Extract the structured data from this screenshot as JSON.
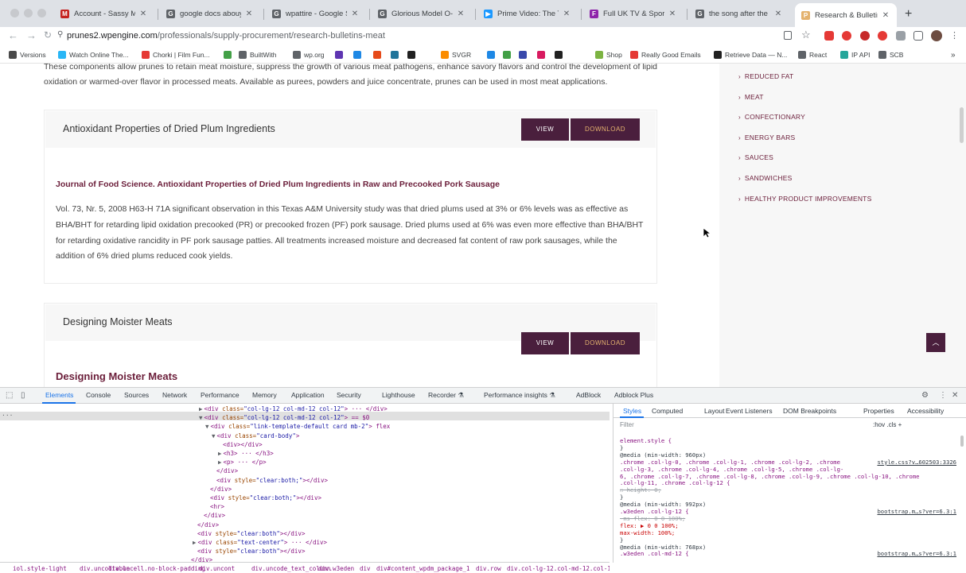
{
  "tabs": [
    {
      "title": "Account - Sassy Ma",
      "color": "#c5221f",
      "glyph": "M"
    },
    {
      "title": "google docs abouy",
      "color": "#5f6368",
      "glyph": "G"
    },
    {
      "title": "wpattire - Google Se",
      "color": "#5f6368",
      "glyph": "G"
    },
    {
      "title": "Glorious Model O- W",
      "color": "#5f6368",
      "glyph": "G"
    },
    {
      "title": "Prime Video: The Te",
      "color": "#1a98ff",
      "glyph": "▶"
    },
    {
      "title": "Full UK TV & Sports",
      "color": "#8e24aa",
      "glyph": "F"
    },
    {
      "title": "the song after the b",
      "color": "#5f6368",
      "glyph": "G"
    },
    {
      "title": "Research & Bulletins",
      "color": "#e4b26e",
      "glyph": "P"
    }
  ],
  "url": {
    "host": "prunes2.wpengine.com",
    "path": "/professionals/supply-procurement/research-bulletins-meat"
  },
  "bookmarks": [
    {
      "label": "Versions",
      "color": "#4a4a4a"
    },
    {
      "label": "Watch Online The...",
      "color": "#29b6f6"
    },
    {
      "label": "Chorki | Film Fun...",
      "color": "#e53935"
    },
    {
      "label": "",
      "color": "#43a047"
    },
    {
      "label": "BuiltWith",
      "color": "#5f6368"
    },
    {
      "label": "wp.org",
      "color": "#5f6368"
    },
    {
      "label": "",
      "color": "#5e35b1"
    },
    {
      "label": "",
      "color": "#1e88e5"
    },
    {
      "label": "",
      "color": "#e64a19"
    },
    {
      "label": "",
      "color": "#21759b"
    },
    {
      "label": "",
      "color": "#212121"
    },
    {
      "label": "SVGR",
      "color": "#fb8c00"
    },
    {
      "label": "",
      "color": "#1e88e5"
    },
    {
      "label": "",
      "color": "#43a047"
    },
    {
      "label": "",
      "color": "#3949ab"
    },
    {
      "label": "",
      "color": "#d81b60"
    },
    {
      "label": "",
      "color": "#212121"
    },
    {
      "label": "Shop",
      "color": "#7cb342"
    },
    {
      "label": "Really Good Emails",
      "color": "#e53935"
    },
    {
      "label": "Retrieve Data — N...",
      "color": "#212121"
    },
    {
      "label": "React",
      "color": "#5f6368"
    },
    {
      "label": "IP API",
      "color": "#26a69a"
    },
    {
      "label": "SCB",
      "color": "#5f6368"
    }
  ],
  "page": {
    "lead_text": "These components allow prunes to retain meat moisture, suppress the growth of various meat pathogens, enhance savory flavors and control the development of lipid oxidation or warmed-over flavor in processed meats. Available as purees, powders and juice concentrate, prunes can be used in most meat applications.",
    "cards": [
      {
        "title": "Antioxidant Properties of Dried Plum Ingredients",
        "view_label": "VIEW",
        "download_label": "DOWNLOAD",
        "journal": "Journal of Food Science. Antioxidant Properties of Dried Plum Ingredients in Raw and Precooked Pork Sausage",
        "body": "Vol. 73, Nr. 5, 2008 H63-H 71A significant observation in this Texas A&M University study was that dried plums used at 3% or 6% levels was as effective as BHA/BHT for retarding lipid oxidation precooked (PR) or precooked frozen (PF) pork sausage. Dried plums used at 6% was even more effective than BHA/BHT for retarding oxidative rancidity in PF pork sausage patties. All treatments increased moisture and decreased fat content of raw pork sausages, while the addition of 6% dried plums reduced cook yields."
      },
      {
        "title": "Designing Moister Meats",
        "view_label": "VIEW",
        "download_label": "DOWNLOAD",
        "subhead": "Designing Moister Meats"
      }
    ],
    "sidebar": [
      "REDUCED FAT",
      "MEAT",
      "CONFECTIONARY",
      "ENERGY BARS",
      "SAUCES",
      "SANDWICHES",
      "HEALTHY PRODUCT IMPROVEMENTS"
    ]
  },
  "devtools": {
    "tabs": [
      "Elements",
      "Console",
      "Sources",
      "Network",
      "Performance",
      "Memory",
      "Application",
      "Security",
      "Lighthouse",
      "Recorder ⚗",
      "Performance insights ⚗",
      "AdBlock",
      "Adblock Plus"
    ],
    "side_tabs": [
      "Styles",
      "Computed",
      "Layout",
      "Event Listeners",
      "DOM Breakpoints",
      "Properties",
      "Accessibility"
    ],
    "filter_placeholder": "Filter",
    "filter_tools": ":hov  .cls  +",
    "eq_sign": "== $0",
    "code_lines": [
      {
        "indent": 250,
        "tri": "▶",
        "tag": "<div ",
        "attr": "class=",
        "val": "\"col-lg-12 col-md-12 col-12\"",
        "end": "> ··· </div>"
      },
      {
        "indent": 250,
        "tri": "▼",
        "tag": "<div ",
        "attr": "class=",
        "val": "\"col-lg-12 col-md-12 col-12\"",
        "end": "> == $0"
      },
      {
        "indent": 258,
        "tri": "▼",
        "tag": "<div ",
        "attr": "class=",
        "val": "\"link-template-default card mb-2\"",
        "end": "> flex"
      },
      {
        "indent": 266,
        "tri": "▼",
        "tag": "<div ",
        "attr": "class=",
        "val": "\"card-body\"",
        "end": ">"
      },
      {
        "indent": 280,
        "tri": "",
        "tag": "<div></div>",
        "attr": "",
        "val": "",
        "end": ""
      },
      {
        "indent": 274,
        "tri": "▶",
        "tag": "<h3> ··· </h3>",
        "attr": "",
        "val": "",
        "end": ""
      },
      {
        "indent": 274,
        "tri": "▶",
        "tag": "<p> ··· </p>",
        "attr": "",
        "val": "",
        "end": ""
      },
      {
        "indent": 272,
        "tri": "",
        "tag": "</div>",
        "attr": "",
        "val": "",
        "end": ""
      },
      {
        "indent": 272,
        "tri": "",
        "tag": "<div ",
        "attr": "style=",
        "val": "\"clear:both;\"",
        "end": "></div>"
      },
      {
        "indent": 264,
        "tri": "",
        "tag": "</div>",
        "attr": "",
        "val": "",
        "end": ""
      },
      {
        "indent": 264,
        "tri": "",
        "tag": "<div ",
        "attr": "style=",
        "val": "\"clear:both;\"",
        "end": "></div>"
      },
      {
        "indent": 264,
        "tri": "",
        "tag": "<hr>",
        "attr": "",
        "val": "",
        "end": ""
      },
      {
        "indent": 256,
        "tri": "",
        "tag": "</div>",
        "attr": "",
        "val": "",
        "end": ""
      },
      {
        "indent": 248,
        "tri": "",
        "tag": "</div>",
        "attr": "",
        "val": "",
        "end": ""
      },
      {
        "indent": 248,
        "tri": "",
        "tag": "<div ",
        "attr": "style=",
        "val": "\"clear:both\"",
        "end": "></div>"
      },
      {
        "indent": 242,
        "tri": "▶",
        "tag": "<div ",
        "attr": "class=",
        "val": "\"text-center\"",
        "end": "> ··· </div>"
      },
      {
        "indent": 248,
        "tri": "",
        "tag": "<div ",
        "attr": "style=",
        "val": "\"clear:both\"",
        "end": "></div>"
      },
      {
        "indent": 240,
        "tri": "",
        "tag": "</div>",
        "attr": "",
        "val": "",
        "end": ""
      }
    ],
    "css": [
      {
        "cls": "sel",
        "text": "element.style {"
      },
      {
        "cls": "",
        "text": "}"
      },
      {
        "cls": "media",
        "text": "@media (min-width: 960px)"
      },
      {
        "cls": "sel",
        "text": ".chrome .col-lg-0, .chrome .col-lg-1, .chrome .col-lg-2, .chrome"
      },
      {
        "cls": "sel",
        "text": ".col-lg-3, .chrome .col-lg-4, .chrome .col-lg-5, .chrome .col-lg-"
      },
      {
        "cls": "sel",
        "text": "6, .chrome .col-lg-7, .chrome .col-lg-8, .chrome .col-lg-9, .chrome .col-lg-10, .chrome"
      },
      {
        "cls": "sel",
        "text": ".col-lg-11, .chrome .col-lg-12 {"
      },
      {
        "cls": "strike",
        "text": "☐ height: 0;"
      },
      {
        "cls": "",
        "text": "}"
      },
      {
        "cls": "media",
        "text": "@media (min-width: 992px)"
      },
      {
        "cls": "sel",
        "text": ".w3eden .col-lg-12 {"
      },
      {
        "cls": "strike",
        "text": "  -ms-flex: 0 0 100%;"
      },
      {
        "cls": "prop",
        "text": "  flex: ▶ 0 0 100%;"
      },
      {
        "cls": "prop",
        "text": "  max-width: 100%;"
      },
      {
        "cls": "",
        "text": "}"
      },
      {
        "cls": "media",
        "text": "@media (min-width: 768px)"
      },
      {
        "cls": "sel",
        "text": ".w3eden .col-md-12 {"
      }
    ],
    "css_sources": [
      {
        "row": 3,
        "text": "style.css?v…602503:3326"
      },
      {
        "row": 10,
        "text": "bootstrap.m…s?ver=6.3:1"
      },
      {
        "row": 16,
        "text": "bootstrap.m…s?ver=6.3:1"
      }
    ],
    "breadcrumbs": [
      "iol.style-light",
      "div.uncoltable",
      "div.uncell.no-block-padding",
      "div.uncont",
      "div.uncode_text_column",
      "div.w3eden",
      "div",
      "div#content_wpdm_package_1",
      "div.row",
      "div.col-lg-12.col-md-12.col-12"
    ]
  }
}
